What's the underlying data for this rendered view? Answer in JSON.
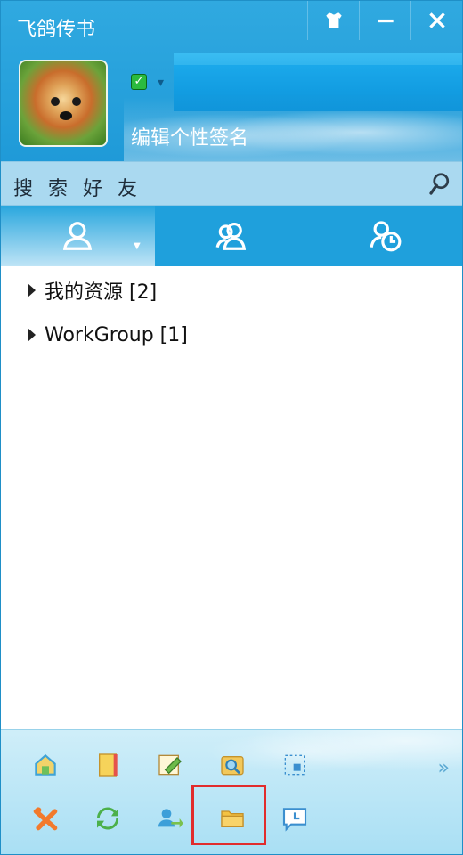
{
  "window": {
    "title": "飞鸽传书",
    "controls": {
      "skin_icon": "shirt-icon",
      "minimize_icon": "minimize-icon",
      "close_icon": "close-icon"
    }
  },
  "profile": {
    "avatar": "dog-avatar",
    "status_icon": "online-check-icon",
    "signature": "编辑个性签名"
  },
  "search": {
    "placeholder": "搜 索 好 友",
    "icon": "search-icon"
  },
  "tabs": [
    {
      "icon": "contact-icon",
      "active": true
    },
    {
      "icon": "group-icon",
      "active": false
    },
    {
      "icon": "recent-icon",
      "active": false
    }
  ],
  "groups": [
    {
      "label": "我的资源 [2]"
    },
    {
      "label": "WorkGroup [1]"
    }
  ],
  "toolbar": {
    "row1": [
      "home-icon",
      "notebook-icon",
      "edit-note-icon",
      "search-folder-icon",
      "screenshot-icon"
    ],
    "row2": [
      "tools-icon",
      "refresh-icon",
      "contact-transfer-icon",
      "folder-icon",
      "message-icon"
    ],
    "more": "»"
  },
  "colors": {
    "accent": "#1fa0dc",
    "highlight": "#e12c2c"
  }
}
